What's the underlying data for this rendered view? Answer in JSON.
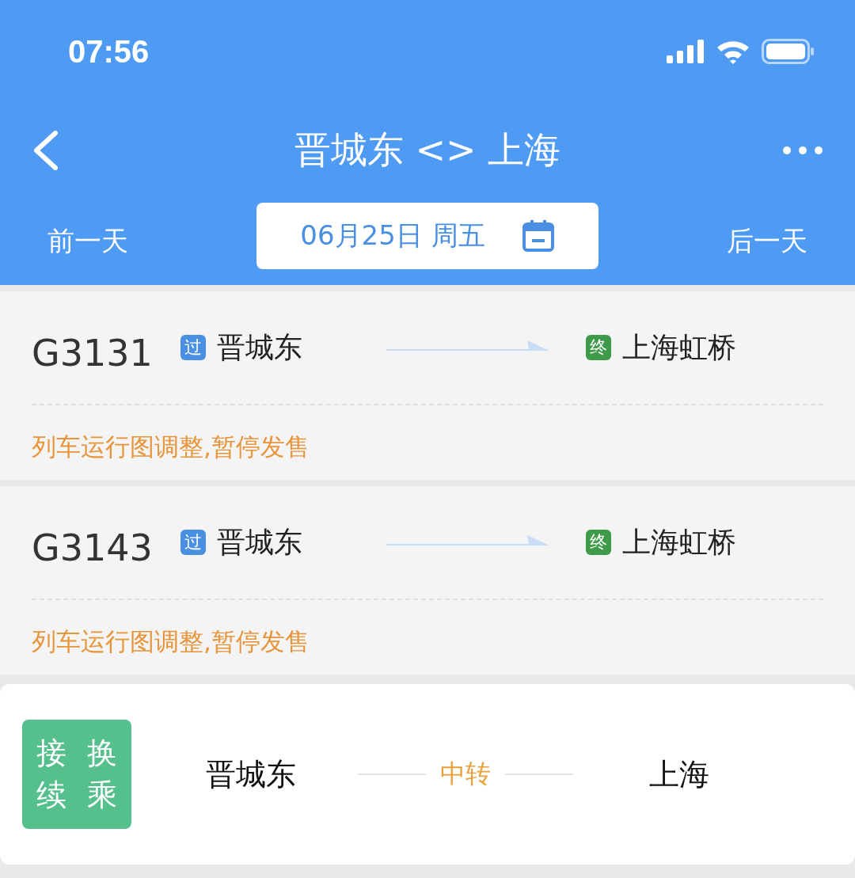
{
  "status_bar": {
    "time": "07:56"
  },
  "header": {
    "title": "晋城东 <> 上海"
  },
  "date_bar": {
    "prev": "前一天",
    "date": "06月25日 周五",
    "next": "后一天"
  },
  "trains": [
    {
      "number": "G3131",
      "from": {
        "tag": "过",
        "color": "#4a90e2",
        "name": "晋城东"
      },
      "to": {
        "tag": "终",
        "color": "#3f9b4a",
        "name": "上海虹桥"
      },
      "notice": "列车运行图调整,暂停发售"
    },
    {
      "number": "G3143",
      "from": {
        "tag": "过",
        "color": "#4a90e2",
        "name": "晋城东"
      },
      "to": {
        "tag": "终",
        "color": "#3f9b4a",
        "name": "上海虹桥"
      },
      "notice": "列车运行图调整,暂停发售"
    }
  ],
  "transfer": {
    "badge_columns": [
      "接续",
      "换乘"
    ],
    "from": "晋城东",
    "via": "中转",
    "to": "上海"
  }
}
